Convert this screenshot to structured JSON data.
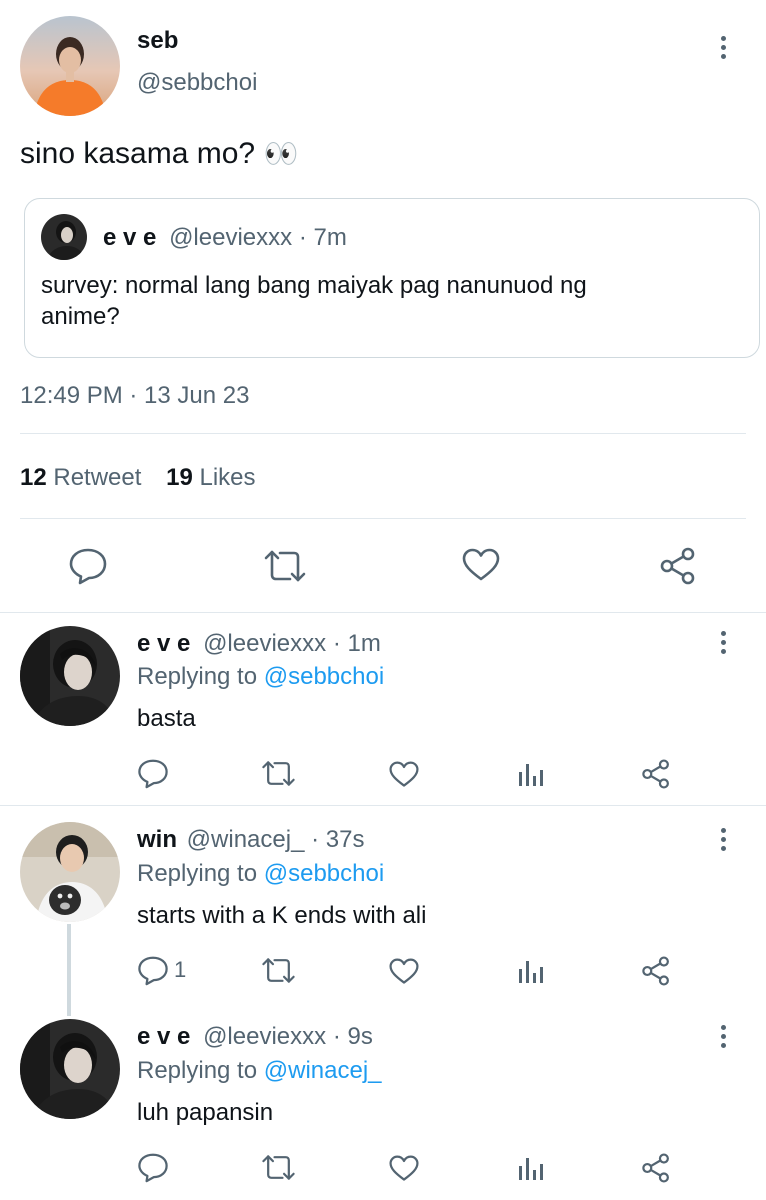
{
  "tweet": {
    "name": "seb",
    "handle": "@sebbchoi",
    "text": "sino kasama mo?",
    "emoji": "👀",
    "quote": {
      "name": "e v e",
      "handle": "@leeviexxx",
      "time": "· 7m",
      "text_line1": "survey: normal lang bang maiyak pag nanunuod ng",
      "text_line2": "anime?"
    },
    "timestamp": "12:49 PM · 13 Jun 23",
    "retweet_count": "12",
    "retweet_label": "Retweet",
    "likes_count": "19",
    "likes_label": "Likes"
  },
  "replies": [
    {
      "name": "e v e",
      "handle": "@leeviexxx",
      "time": "· 1m",
      "replying_prefix": "Replying to",
      "replying_to": "@sebbchoi",
      "text": "basta",
      "reply_count": ""
    },
    {
      "name": "win",
      "handle": "@winacej_",
      "time": "· 37s",
      "replying_prefix": "Replying to",
      "replying_to": "@sebbchoi",
      "text": "starts with a K ends with ali",
      "reply_count": "1"
    },
    {
      "name": "e v e",
      "handle": "@leeviexxx",
      "time": "· 9s",
      "replying_prefix": "Replying to",
      "replying_to": "@winacej_",
      "text": "luh papansin",
      "reply_count": ""
    }
  ],
  "colors": {
    "text": "#0f1419",
    "secondary": "#536471",
    "link": "#1d9bf0",
    "divider": "#e1e8ed"
  },
  "icons": {
    "reply": "reply-icon",
    "retweet": "retweet-icon",
    "like": "heart-icon",
    "share": "share-icon",
    "analytics": "analytics-icon",
    "more": "more-icon"
  }
}
